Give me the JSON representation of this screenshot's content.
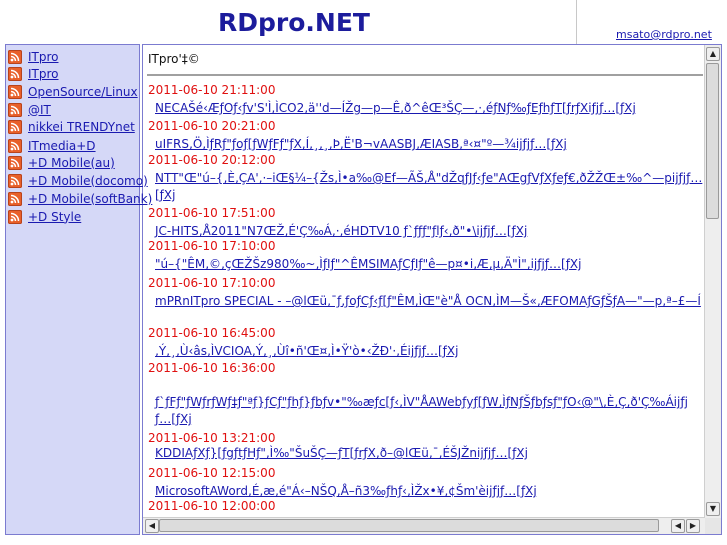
{
  "header": {
    "title": "RDpro.NET",
    "user_email": "msato@rdpro.net"
  },
  "sidebar": {
    "items": [
      {
        "label": "ITpro "
      },
      {
        "label": "ITpro "
      },
      {
        "label": "OpenSource/Linux"
      },
      {
        "label": "@IT"
      },
      {
        "label": "nikkei TRENDYnet"
      },
      {
        "label": "ITmedia+D"
      },
      {
        "label": "+D Mobile(au)"
      },
      {
        "label": "+D Mobile(docomo)"
      },
      {
        "label": "+D Mobile(softBank)"
      },
      {
        "label": "+D Style"
      }
    ]
  },
  "main": {
    "heading": "ITpro'‡©",
    "entries": [
      {
        "date": "2011-06-10 21:11:00",
        "title": "NECAŠé‹ÆƒOƒ‹ƒv'S'Ì‚ÌCO2‚ä''d—ÍŽg—p—Ê‚ð^êŒ³ŠÇ—‚·‚éƒNƒ‰ƒEƒhƒT[ƒrƒXiƒjƒ…[ƒXj"
      },
      {
        "date": "2011-06-10 20:21:00",
        "title": "uIFRS‚Ö‚ÌƒRƒ\"ƒoƒ[ƒWƒFƒ\"ƒX‚Í‚¸‚¸‚Þ‚Ë'B¬vAASBJ‚ÆIASB‚ª‹¤\"º—¾ijƒjƒ…[ƒXj"
      },
      {
        "date": "2011-06-10 20:12:00",
        "title": "NTT\"Œ\"ú–{‚È‚ÇA'‚·–iŒ§¼–{Žs‚Ì•a‰@Ef—ÃŠ‚Å\"dŽqƒJƒ‹ƒe\"AŒgƒVƒXƒeƒ€‚ðŽŽŒ±‰^—pijƒjƒ…[ƒXj"
      },
      {
        "date": "2011-06-10 17:51:00",
        "title": "JC-HITS‚Å2011\"N7ŒŽ‚É'Ç‰Á‚·‚éHDTV10 ƒ`ƒƒƒ\"ƒlƒ‹‚ð\"•\\ijƒjƒ…[ƒXj"
      },
      {
        "date": "2011-06-10 17:10:00",
        "title": "\"ú–{\"ÊM‚©‚çŒŽŠz980‰~‚ÌƒIƒ\"^ÊMSIMAƒCƒIƒ\"ê—p¤•i‚Æ‚µ‚Ä\"Ì\"‚ijƒjƒ…[ƒXj"
      },
      {
        "date": "2011-06-10 17:10:00",
        "title": "mPRnITpro SPECIAL - –@lŒü‚¯ƒ‚ƒoƒCƒ‹ƒ[ƒ\"ÊM‚ÌŒ\"è\"Å OCN‚ÌM—Š«‚ÆFOMAƒGƒŠƒA—\"—p‚ª–£—Í"
      },
      {
        "date": "2011-06-10 16:45:00",
        "title": "‚Ý‚¸‚Ù‹âs‚ÌVCIOA‚Ý‚¸‚Ùî•ñ'Œ¤‚Ì•Ÿ'ò•‹ŽÐ'·‚Éijƒjƒ…[ƒXj"
      },
      {
        "date": "2011-06-10 16:36:00",
        "title": "ƒ`ƒFƒ\"ƒWƒrƒWƒ‡ƒ\"ªƒ}ƒCƒ\"ƒhƒ}ƒbƒv•\"‰æƒc[ƒ‹‚ÌV\"ÅAWebƒyƒ[ƒW‚ÌƒNƒŠƒbƒsƒ\"ƒO‹@\"\\‚È‚Ç‚ð'Ç‰Áijƒjƒ…[ƒXj"
      },
      {
        "date": "2011-06-10 13:21:00",
        "title": "KDDIAƒXƒ}[ƒgƒtƒHƒ\"‚Ì‰\"ŠuŠÇ—ƒT[ƒrƒX‚ð–@lŒü‚¯‚ÉŠJŽnijƒjƒ…[ƒXj"
      },
      {
        "date": "2011-06-10 12:15:00",
        "title": "MicrosoftAWord‚É‚æ‚é\"Á‹–NŠQ‚Å–ñ3‰ƒhƒ‹‚ÌŽx•¥‚¢Šm'èijƒjƒ…[ƒXj"
      },
      {
        "date": "2011-06-10 12:00:00",
        "title": ""
      }
    ]
  }
}
